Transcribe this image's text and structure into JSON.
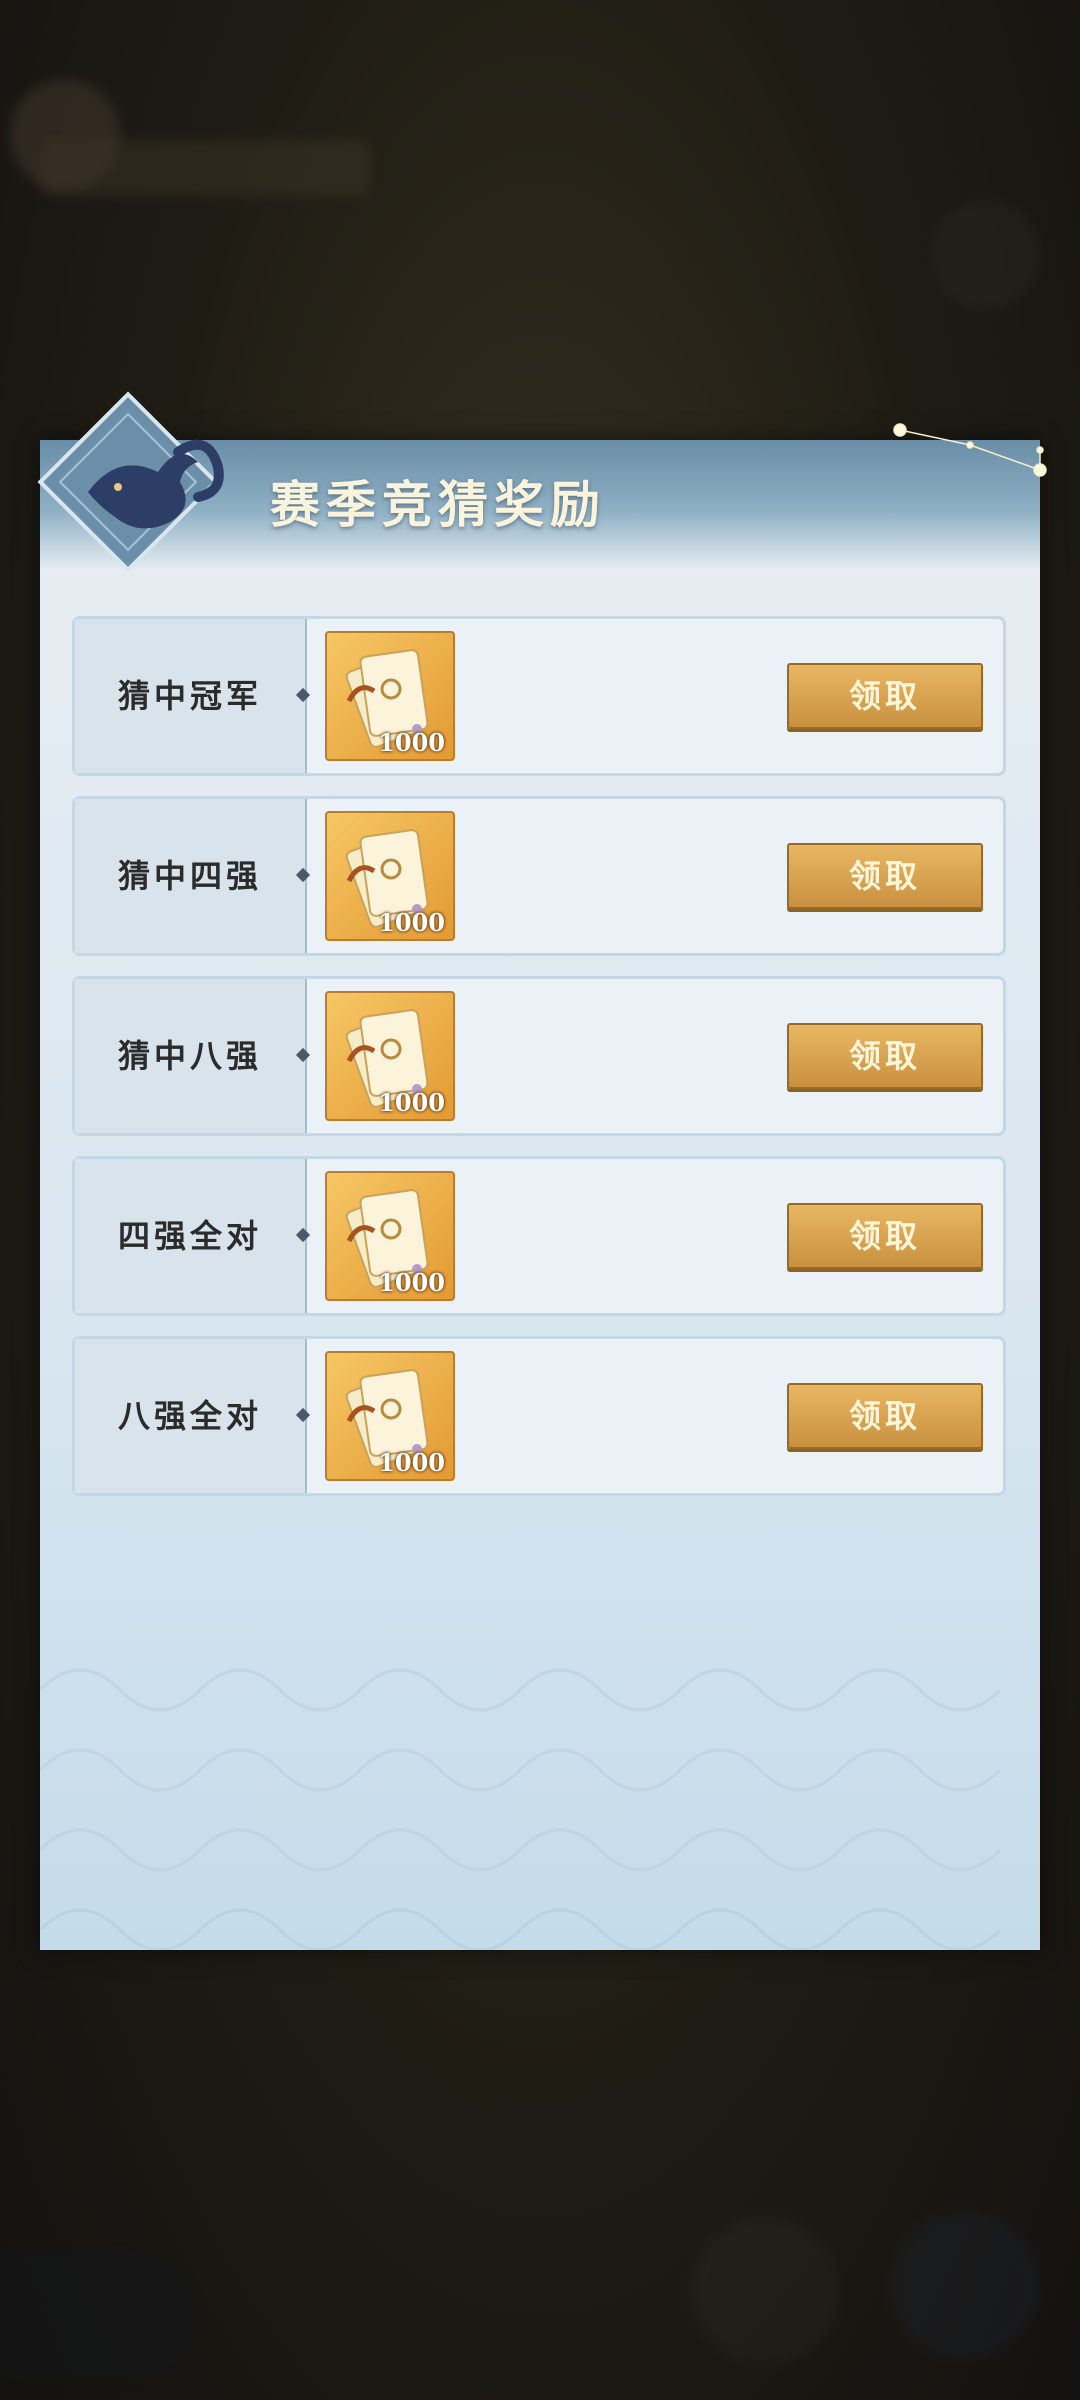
{
  "panel": {
    "title": "赛季竞猜奖励"
  },
  "rewards": [
    {
      "label": "猜中冠军",
      "qty": "1000",
      "button": "领取"
    },
    {
      "label": "猜中四强",
      "qty": "1000",
      "button": "领取"
    },
    {
      "label": "猜中八强",
      "qty": "1000",
      "button": "领取"
    },
    {
      "label": "四强全对",
      "qty": "1000",
      "button": "领取"
    },
    {
      "label": "八强全对",
      "qty": "1000",
      "button": "领取"
    }
  ],
  "colors": {
    "panel": "#dbe7f0",
    "header": "#7f9fb6",
    "button": "#d9a550",
    "item_bg": "#f0b24a"
  },
  "icons": [
    "fox-emblem-icon",
    "constellation-icon",
    "reward-ticket-icon"
  ]
}
